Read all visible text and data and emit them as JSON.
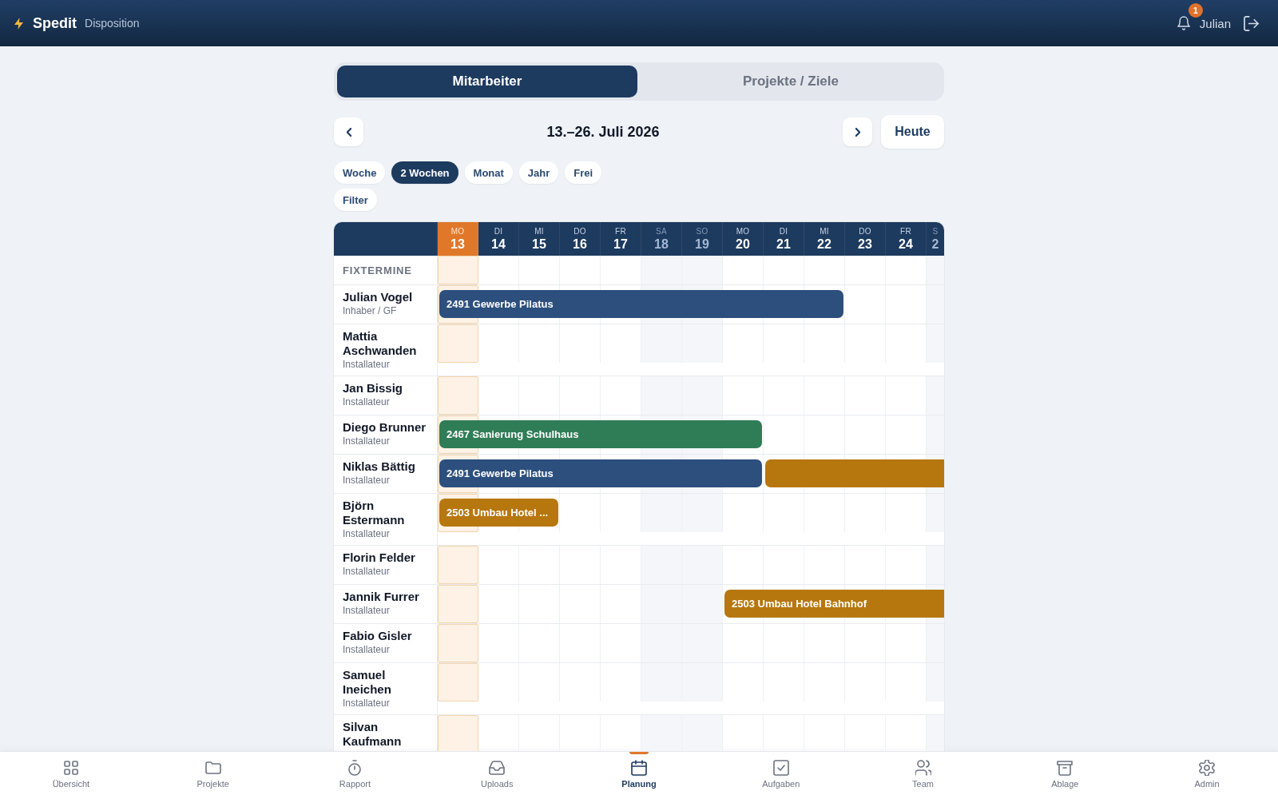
{
  "app_bar": {
    "brand": "Spedit",
    "subtitle": "Disposition",
    "notifications": "1",
    "user": "Julian"
  },
  "view_tabs": [
    {
      "label": "Mitarbeiter",
      "selected": true
    },
    {
      "label": "Projekte / Ziele",
      "selected": false
    }
  ],
  "date_nav": {
    "title": "13.–26. Juli 2026",
    "today_button": "Heute"
  },
  "range_options": [
    {
      "label": "Woche",
      "selected": false
    },
    {
      "label": "2 Wochen",
      "selected": true
    },
    {
      "label": "Monat",
      "selected": false
    },
    {
      "label": "Jahr",
      "selected": false
    },
    {
      "label": "Frei",
      "selected": false
    }
  ],
  "filter_button": "Filter",
  "schedule": {
    "days": [
      {
        "weekday": "MO",
        "date": "13",
        "today": true,
        "weekend": false
      },
      {
        "weekday": "DI",
        "date": "14",
        "today": false,
        "weekend": false
      },
      {
        "weekday": "MI",
        "date": "15",
        "today": false,
        "weekend": false
      },
      {
        "weekday": "DO",
        "date": "16",
        "today": false,
        "weekend": false
      },
      {
        "weekday": "FR",
        "date": "17",
        "today": false,
        "weekend": false
      },
      {
        "weekday": "SA",
        "date": "18",
        "today": false,
        "weekend": true
      },
      {
        "weekday": "SO",
        "date": "19",
        "today": false,
        "weekend": true
      },
      {
        "weekday": "MO",
        "date": "20",
        "today": false,
        "weekend": false
      },
      {
        "weekday": "DI",
        "date": "21",
        "today": false,
        "weekend": false
      },
      {
        "weekday": "MI",
        "date": "22",
        "today": false,
        "weekend": false
      },
      {
        "weekday": "DO",
        "date": "23",
        "today": false,
        "weekend": false
      },
      {
        "weekday": "FR",
        "date": "24",
        "today": false,
        "weekend": false
      },
      {
        "weekday": "S",
        "date": "2",
        "today": false,
        "weekend": true
      }
    ],
    "fixed_section": "FIXTERMINE",
    "employees": [
      {
        "name": "Julian Vogel",
        "role": "Inhaber / GF",
        "assignments": [
          {
            "label": "2491 Gewerbe Pilatus",
            "color": "#2c4f7d",
            "days": [
              true,
              true,
              true,
              true,
              true,
              true,
              true,
              true,
              true,
              true,
              false,
              false,
              false
            ]
          }
        ]
      },
      {
        "name": "Mattia Aschwanden",
        "role": "Installateur"
      },
      {
        "name": "Jan Bissig",
        "role": "Installateur"
      },
      {
        "name": "Diego Brunner",
        "role": "Installateur",
        "assignments": [
          {
            "label": "2467 Sanierung Schulhaus",
            "color": "#2f7d57",
            "days": [
              true,
              true,
              true,
              true,
              true,
              true,
              true,
              true,
              false,
              false,
              false,
              false,
              false
            ]
          }
        ]
      },
      {
        "name": "Niklas Bättig",
        "role": "Installateur",
        "assignments": [
          {
            "label": "2491 Gewerbe Pilatus",
            "color": "#2c4f7d",
            "days": [
              true,
              true,
              true,
              true,
              true,
              true,
              true,
              true,
              false,
              false,
              false,
              false,
              false
            ]
          },
          {
            "color": "#b7770f",
            "days": [
              false,
              false,
              false,
              false,
              false,
              false,
              false,
              false,
              true,
              true,
              true,
              true,
              true
            ]
          }
        ]
      },
      {
        "name": "Björn Estermann",
        "role": "Installateur",
        "assignments": [
          {
            "label": "2503 Umbau Hotel ...",
            "color": "#b7770f",
            "days": [
              true,
              true,
              true,
              false,
              false,
              false,
              false,
              false,
              false,
              false,
              false,
              false,
              false
            ]
          }
        ]
      },
      {
        "name": "Florin Felder",
        "role": "Installateur"
      },
      {
        "name": "Jannik Furrer",
        "role": "Installateur",
        "assignments": [
          {
            "label": "2503 Umbau Hotel Bahnhof",
            "color": "#b7770f",
            "days": [
              false,
              false,
              false,
              false,
              false,
              false,
              false,
              true,
              true,
              true,
              true,
              true,
              true
            ]
          }
        ]
      },
      {
        "name": "Fabio Gisler",
        "role": "Installateur"
      },
      {
        "name": "Samuel Ineichen",
        "role": "Installateur"
      },
      {
        "name": "Silvan Kaufmann"
      }
    ]
  },
  "bottom_nav": [
    {
      "label": "Übersicht",
      "selected": false
    },
    {
      "label": "Projekte",
      "selected": false
    },
    {
      "label": "Rapport",
      "selected": false
    },
    {
      "label": "Uploads",
      "selected": false
    },
    {
      "label": "Planung",
      "selected": true
    },
    {
      "label": "Aufgaben",
      "selected": false
    },
    {
      "label": "Team",
      "selected": false
    },
    {
      "label": "Ablage",
      "selected": false
    },
    {
      "label": "Admin",
      "selected": false
    }
  ]
}
